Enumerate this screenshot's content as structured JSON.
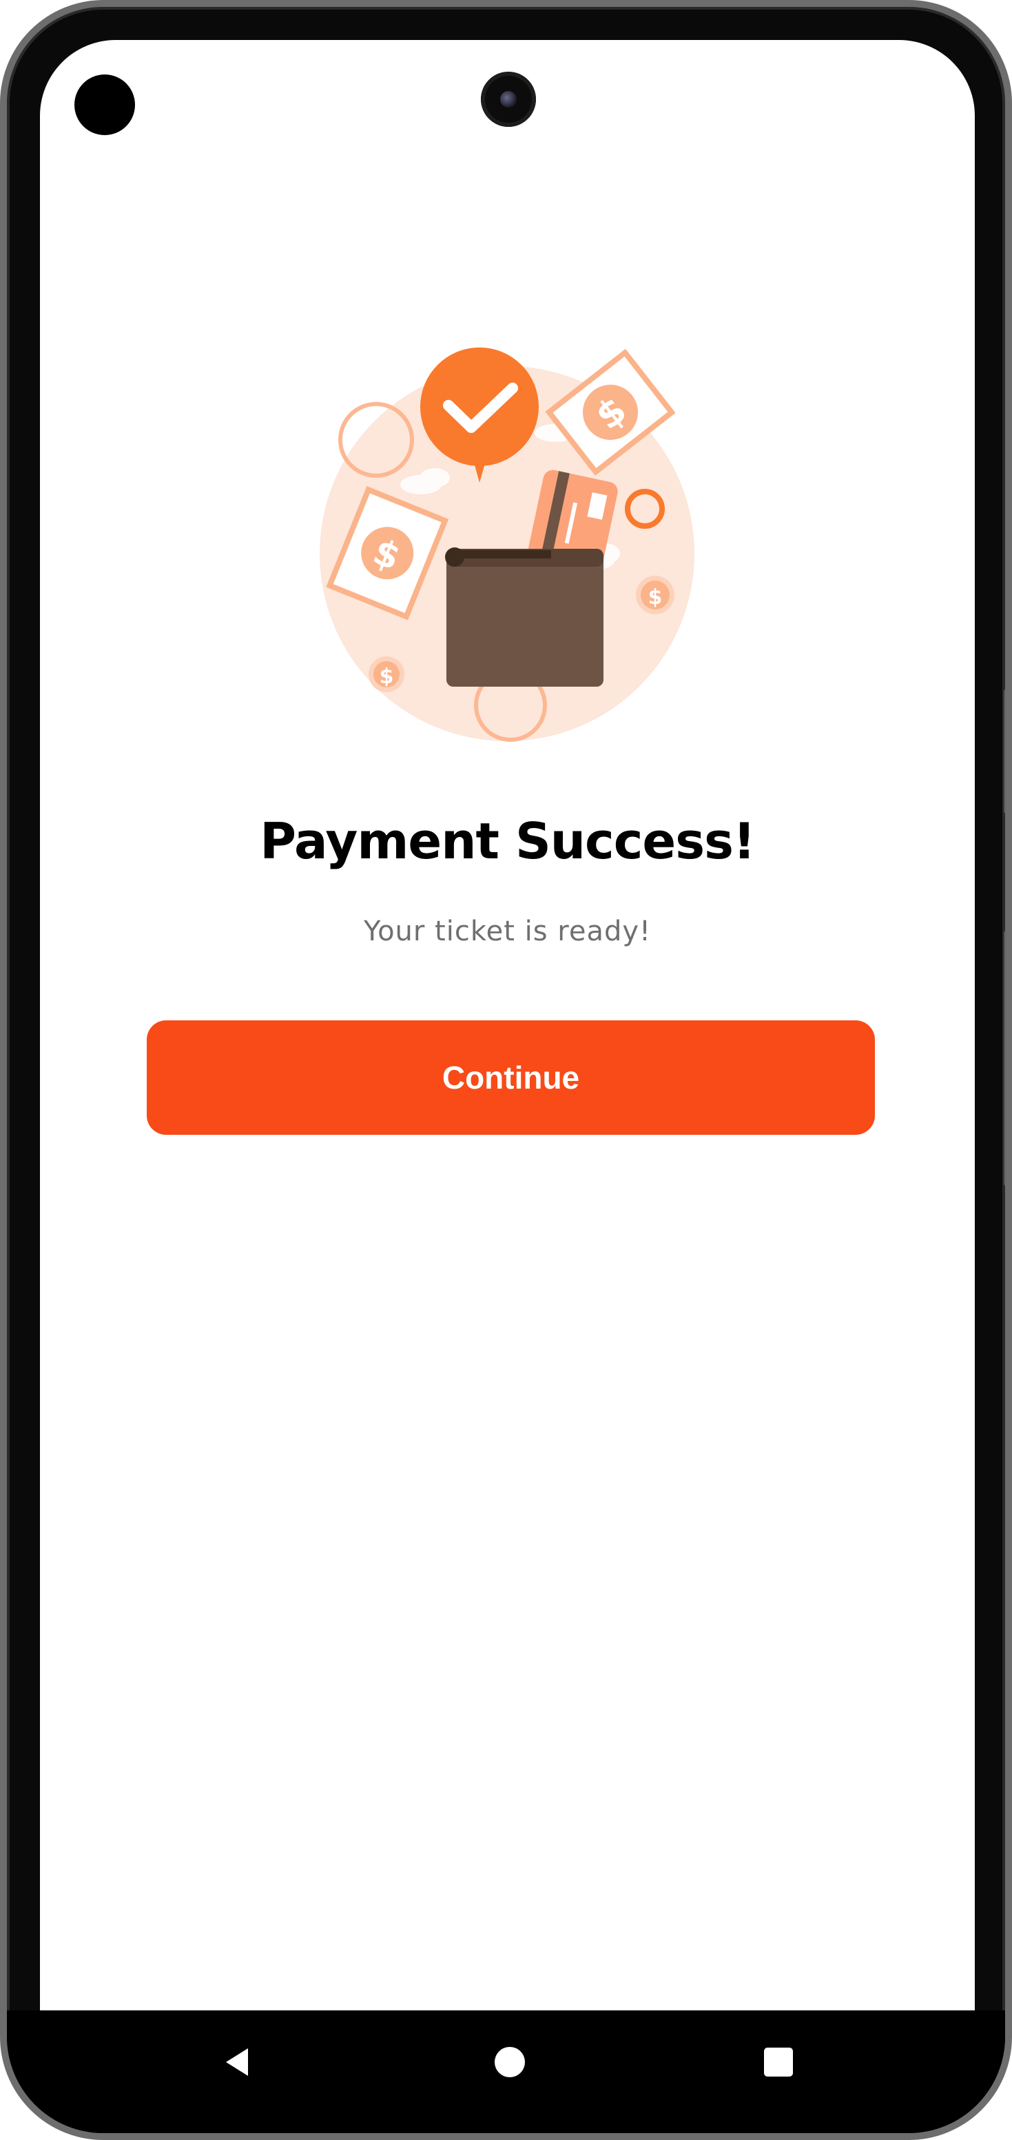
{
  "success": {
    "title": "Payment Success!",
    "subtitle": "Your ticket is ready!",
    "continue_label": "Continue"
  },
  "navbar": {
    "back": "back-icon",
    "home": "home-icon",
    "recent": "recent-apps-icon"
  },
  "colors": {
    "accent": "#f84b17",
    "illustration_orange": "#f97a2c",
    "illustration_peach": "#fde3d6",
    "wallet_brown": "#6e5444"
  }
}
